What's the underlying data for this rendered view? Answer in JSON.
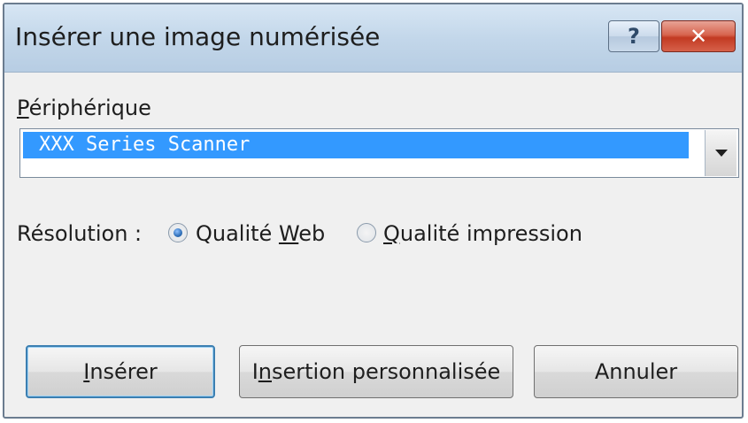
{
  "window": {
    "title": "Insérer une image numérisée",
    "help_glyph": "?",
    "close_glyph": "✕"
  },
  "device": {
    "label_first": "P",
    "label_rest": "ériphérique",
    "selected": "XXX Series Scanner"
  },
  "resolution": {
    "label": "Résolution :",
    "options": [
      {
        "label_pre": "Qualité ",
        "label_u": "W",
        "label_post": "eb",
        "checked": true
      },
      {
        "label_pre": "",
        "label_u": "Q",
        "label_post": "ualité impression",
        "checked": false
      }
    ]
  },
  "buttons": {
    "insert": {
      "u": "I",
      "rest": "nsérer"
    },
    "custom": {
      "pre": "I",
      "u": "n",
      "rest": "sertion personnalisée"
    },
    "cancel": "Annuler"
  },
  "colors": {
    "selection": "#3399ff",
    "close_button": "#c23a22",
    "titlebar": "#c3d7ea"
  }
}
